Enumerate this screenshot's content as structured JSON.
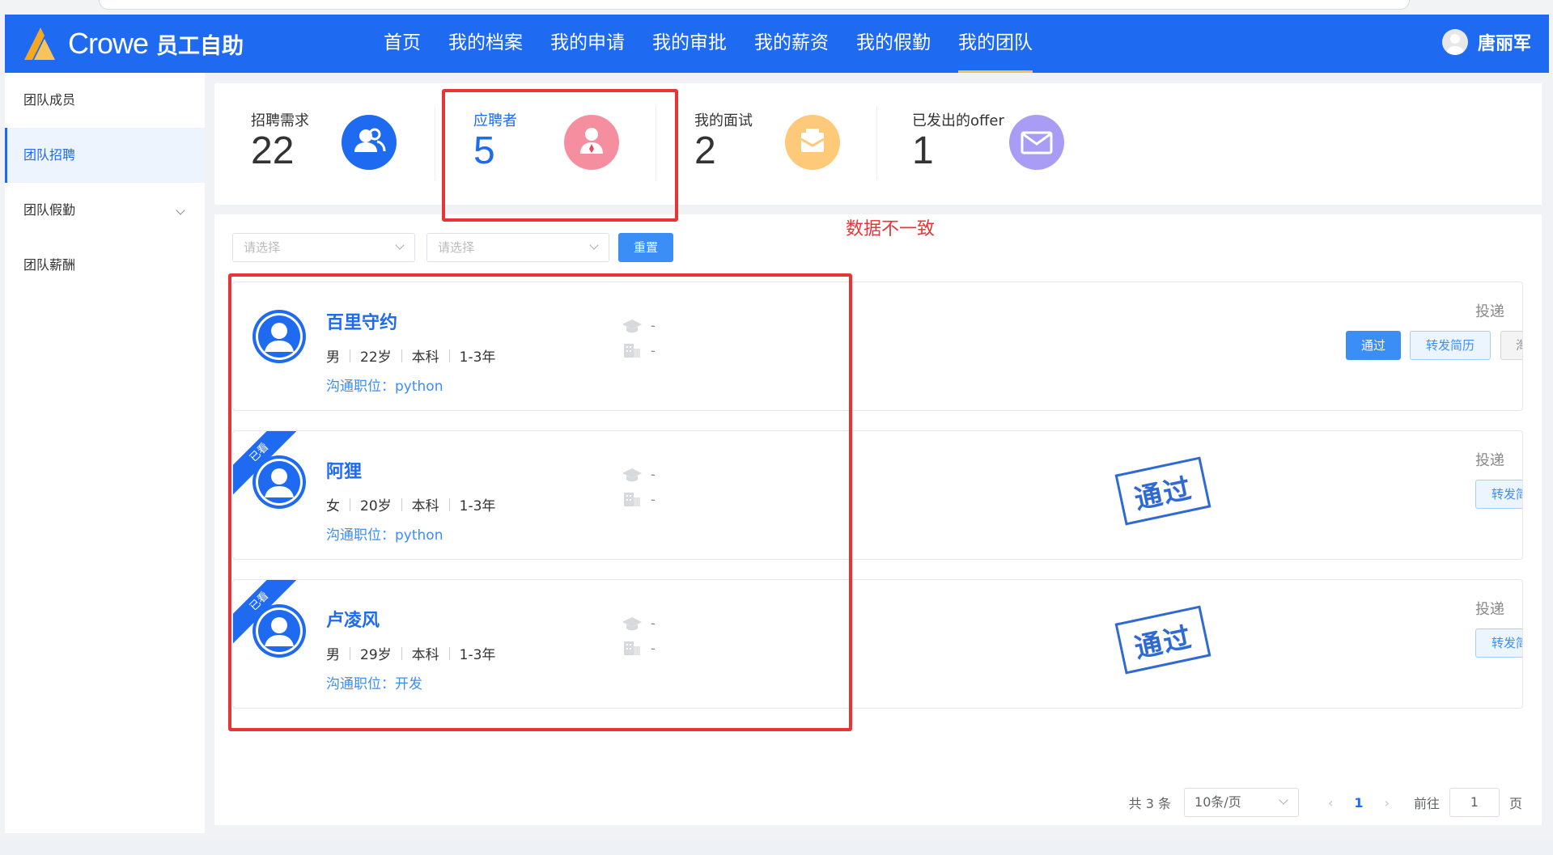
{
  "header": {
    "brand": "Crowe",
    "subtitle": "员工自助",
    "nav": [
      "首页",
      "我的档案",
      "我的申请",
      "我的审批",
      "我的薪资",
      "我的假勤",
      "我的团队"
    ],
    "active_nav": "我的团队",
    "user_name": "唐丽军"
  },
  "sidebar": {
    "items": [
      {
        "label": "团队成员"
      },
      {
        "label": "团队招聘"
      },
      {
        "label": "团队假勤"
      },
      {
        "label": "团队薪酬"
      }
    ],
    "active": "团队招聘"
  },
  "stats": [
    {
      "label": "招聘需求",
      "value": "22",
      "icon": "users-icon",
      "color": "#1e6af0"
    },
    {
      "label": "应聘者",
      "value": "5",
      "icon": "applicant-icon",
      "color": "#f58fa0"
    },
    {
      "label": "我的面试",
      "value": "2",
      "icon": "interview-icon",
      "color": "#ffc97a"
    },
    {
      "label": "已发出的offer",
      "value": "1",
      "icon": "mail-icon",
      "color": "#a99cf5"
    }
  ],
  "annotation": "数据不一致",
  "filters": {
    "select1_placeholder": "请选择",
    "select2_placeholder": "请选择",
    "reset": "重置"
  },
  "candidates": [
    {
      "name": "百里守约",
      "gender": "男",
      "age": "22岁",
      "edu": "本科",
      "exp": "1-3年",
      "position": "沟通职位：python",
      "school": "-",
      "company": "-",
      "viewed": false,
      "status": "投递",
      "actions": [
        "通过",
        "转发简历",
        "淘汰"
      ]
    },
    {
      "name": "阿狸",
      "gender": "女",
      "age": "20岁",
      "edu": "本科",
      "exp": "1-3年",
      "position": "沟通职位：python",
      "school": "-",
      "company": "-",
      "viewed": true,
      "viewed_label": "已看",
      "status": "投递",
      "stamp": "通过",
      "actions": [
        "转发简历"
      ]
    },
    {
      "name": "卢凌风",
      "gender": "男",
      "age": "29岁",
      "edu": "本科",
      "exp": "1-3年",
      "position": "沟通职位：开发",
      "school": "-",
      "company": "-",
      "viewed": true,
      "viewed_label": "已看",
      "status": "投递",
      "stamp": "通过",
      "actions": [
        "转发简历"
      ]
    }
  ],
  "pagination": {
    "total": "共 3 条",
    "page_size": "10条/页",
    "current": "1",
    "goto_label": "前往",
    "goto_value": "1",
    "page_label": "页"
  }
}
